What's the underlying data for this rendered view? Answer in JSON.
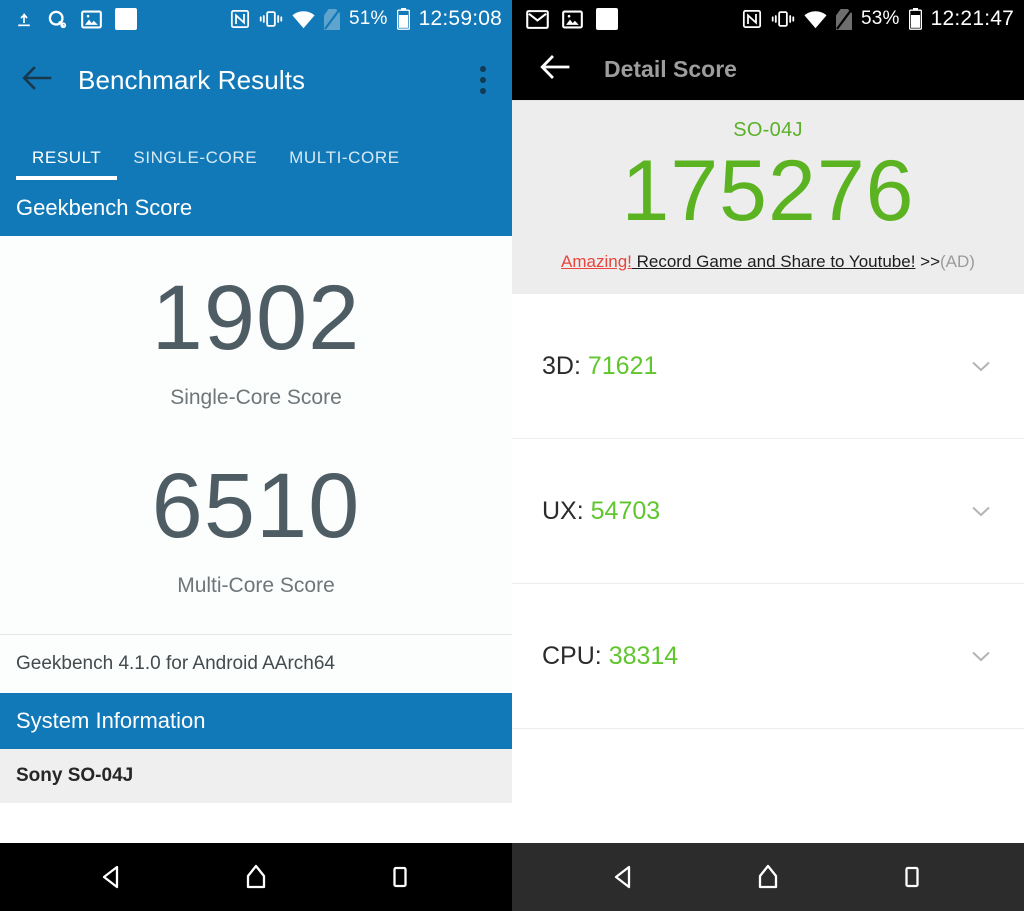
{
  "left_phone": {
    "statusbar": {
      "icons_left": [
        "upload-icon",
        "account-key-icon",
        "image-icon",
        "blank-square-icon"
      ],
      "icons_right": [
        "nfc-icon",
        "vibrate-icon",
        "wifi-icon",
        "no-sim-icon"
      ],
      "battery_percent": "51%",
      "clock": "12:59:08",
      "background": "#1279b8"
    },
    "appbar": {
      "back_icon": "back-arrow-icon",
      "title": "Benchmark Results",
      "overflow_icon": "overflow-menu-icon"
    },
    "tabs": [
      {
        "label": "RESULT",
        "active": true
      },
      {
        "label": "SINGLE-CORE",
        "active": false
      },
      {
        "label": "MULTI-CORE",
        "active": false
      }
    ],
    "section_header": "Geekbench Score",
    "scores": [
      {
        "value": "1902",
        "label": "Single-Core Score"
      },
      {
        "value": "6510",
        "label": "Multi-Core Score"
      }
    ],
    "version_line": "Geekbench 4.1.0 for Android AArch64",
    "system_information_header": "System Information",
    "system_information_first_row": "Sony SO-04J",
    "navbar": {
      "back": "nav-back-icon",
      "home": "nav-home-icon",
      "recents": "nav-recents-icon"
    }
  },
  "right_phone": {
    "statusbar": {
      "icons_left": [
        "gmail-icon",
        "image-icon",
        "blank-square-icon"
      ],
      "icons_right": [
        "nfc-icon",
        "vibrate-icon",
        "wifi-icon",
        "no-sim-icon"
      ],
      "battery_percent": "53%",
      "clock": "12:21:47",
      "background": "#000000"
    },
    "appbar": {
      "back_icon": "back-arrow-icon",
      "title": "Detail Score"
    },
    "hero": {
      "device": "SO-04J",
      "total_score": "175276",
      "score_color": "#5cb321",
      "ad": {
        "highlight": "Amazing!",
        "body": " Record Game and Share to Youtube!",
        "arrows": " >>",
        "tag": "(AD)"
      }
    },
    "rows": [
      {
        "label": "3D:",
        "value": "71621",
        "chevron": "chevron-down-icon"
      },
      {
        "label": "UX:",
        "value": "54703",
        "chevron": "chevron-down-icon"
      },
      {
        "label": "CPU:",
        "value": "38314",
        "chevron": "chevron-down-icon"
      }
    ],
    "navbar": {
      "back": "nav-back-icon",
      "home": "nav-home-icon",
      "recents": "nav-recents-icon"
    }
  }
}
